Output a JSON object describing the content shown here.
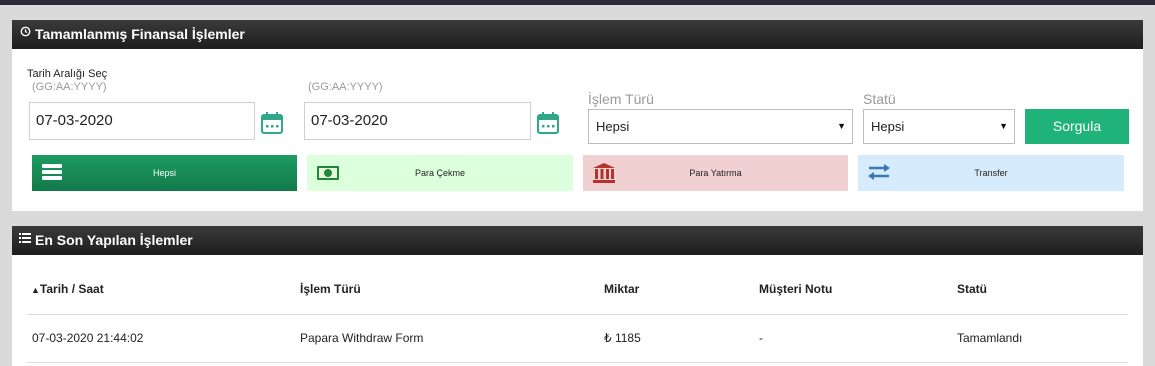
{
  "panel1": {
    "title": "Tamamlanmış Finansal İşlemler",
    "date_range_label": "Tarih Aralığı Seç",
    "date_format_hint": "(GG:AA:YYYY)",
    "start_date": "07-03-2020",
    "end_date": "07-03-2020",
    "transaction_type_label": "İşlem Türü",
    "transaction_type_value": "Hepsi",
    "status_label": "Statü",
    "status_value": "Hepsi",
    "query_button": "Sorgula",
    "filters": [
      {
        "label": "Hepsi",
        "icon": "list-icon",
        "color": "#1c9b62"
      },
      {
        "label": "Para Çekme",
        "icon": "money-icon",
        "color": "#dcffdc"
      },
      {
        "label": "Para Yatırma",
        "icon": "bank-icon",
        "color": "#f0d0d0"
      },
      {
        "label": "Transfer",
        "icon": "transfer-arrows-icon",
        "color": "#d6ebfb"
      }
    ]
  },
  "panel2": {
    "title": "En Son Yapılan İşlemler",
    "columns": [
      "Tarih / Saat",
      "İşlem Türü",
      "Miktar",
      "Müşteri Notu",
      "Statü"
    ],
    "sort_indicator": "▲",
    "rows": [
      [
        "07-03-2020 21:44:02",
        "Papara Withdraw Form",
        "₺ 1185",
        "-",
        "Tamamlandı"
      ]
    ]
  },
  "colors": {
    "accent_green": "#1fb37a",
    "header_dark": "#2a2a2a"
  }
}
